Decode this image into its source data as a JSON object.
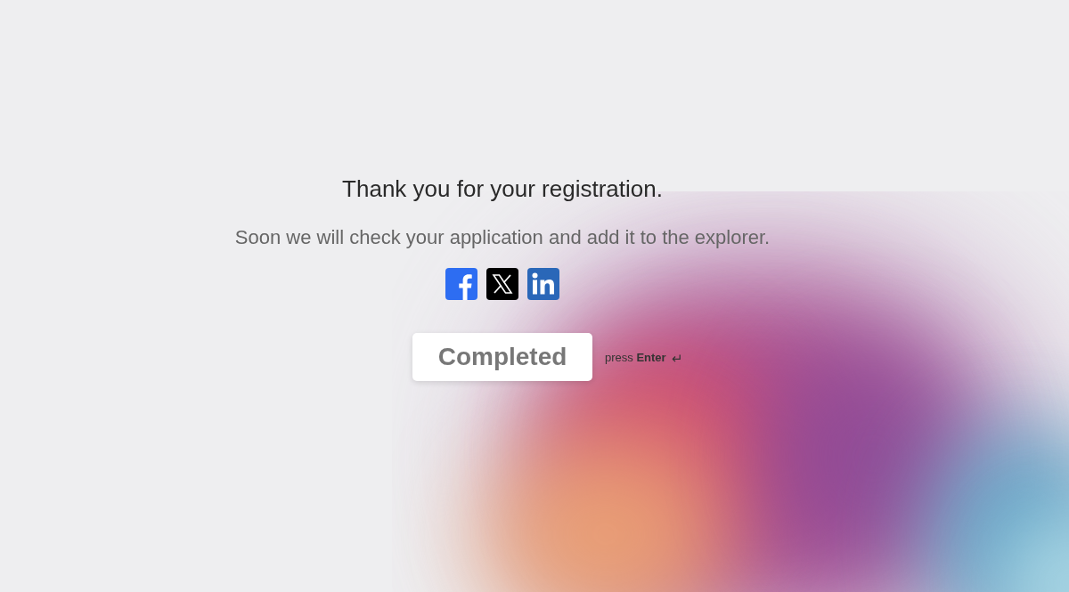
{
  "message": {
    "title": "Thank you for your registration.",
    "subtitle": "Soon we will check your application and add it to the explorer."
  },
  "social_links": [
    {
      "kind": "facebook"
    },
    {
      "kind": "x"
    },
    {
      "kind": "linkedin"
    }
  ],
  "button": {
    "label": "Completed"
  },
  "hint": {
    "text": "press **Enter**",
    "key_icon": "↵"
  }
}
